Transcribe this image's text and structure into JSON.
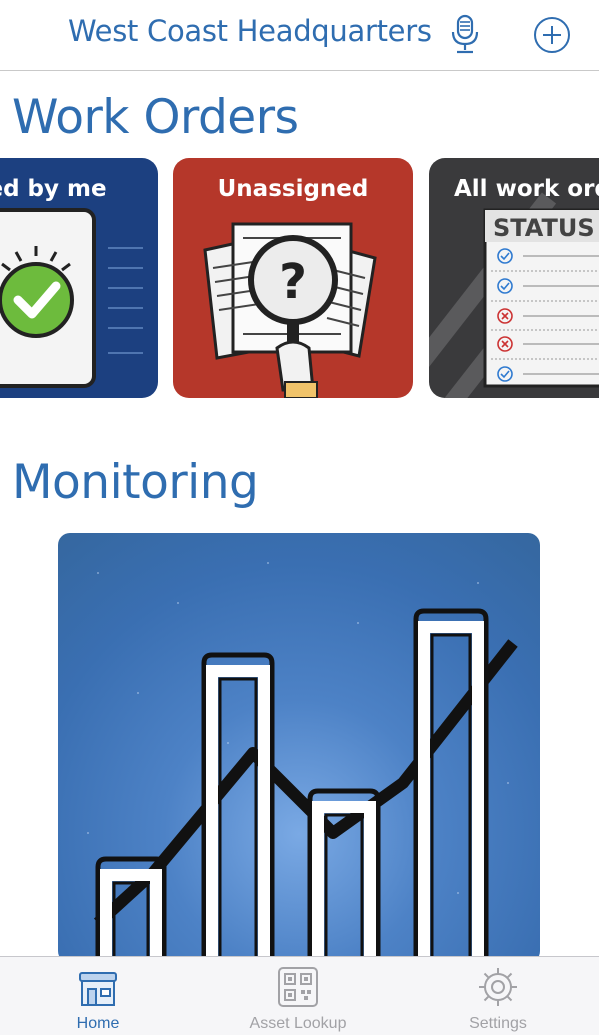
{
  "header": {
    "title": "West Coast Headquarters",
    "mic_icon": "microphone-icon",
    "add_icon": "plus-circle-icon"
  },
  "work_orders": {
    "title": "Work Orders",
    "cards": [
      {
        "label": "leted by me",
        "icon": "phone-checkmark-icon",
        "color": "#1c4080"
      },
      {
        "label": "Unassigned",
        "icon": "magnifier-question-icon",
        "color": "#b5372a"
      },
      {
        "label": "All work ord",
        "icon": "status-checklist-icon",
        "color": "#3a3a3c",
        "status_text": "STATUS"
      }
    ]
  },
  "monitoring": {
    "title": "Monitoring",
    "image": "bar-chart-trend-icon"
  },
  "tabs": [
    {
      "label": "Home",
      "icon": "home-icon",
      "active": true
    },
    {
      "label": "Asset Lookup",
      "icon": "qr-code-icon",
      "active": false
    },
    {
      "label": "Settings",
      "icon": "gear-icon",
      "active": false
    }
  ],
  "colors": {
    "accent": "#2f6db0",
    "inactive": "#a2a2a6"
  }
}
